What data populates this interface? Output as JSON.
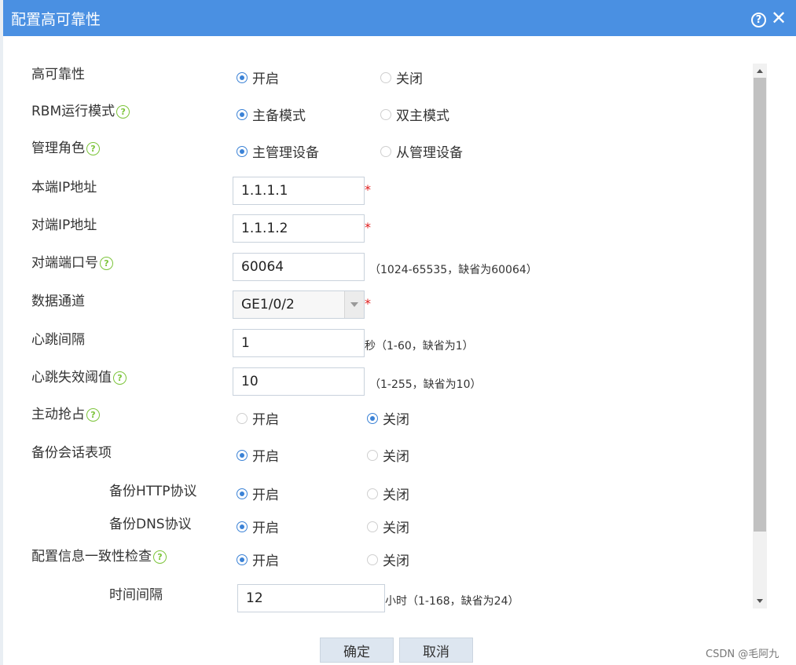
{
  "window": {
    "title": "配置高可靠性",
    "help_glyph": "?",
    "close_glyph": "✕"
  },
  "form": {
    "high_availability": {
      "label": "高可靠性",
      "options": [
        "开启",
        "关闭"
      ],
      "selected": "开启"
    },
    "rbm_mode": {
      "label": "RBM运行模式",
      "options": [
        "主备模式",
        "双主模式"
      ],
      "selected": "主备模式"
    },
    "management_role": {
      "label": "管理角色",
      "options": [
        "主管理设备",
        "从管理设备"
      ],
      "selected": "主管理设备"
    },
    "local_ip": {
      "label": "本端IP地址",
      "value": "1.1.1.1",
      "required": "*"
    },
    "peer_ip": {
      "label": "对端IP地址",
      "value": "1.1.1.2",
      "required": "*"
    },
    "peer_port": {
      "label": "对端端口号",
      "value": "60064",
      "hint": "（1024-65535，缺省为60064）"
    },
    "data_channel": {
      "label": "数据通道",
      "value": "GE1/0/2",
      "required": "*"
    },
    "heartbeat_interval": {
      "label": "心跳间隔",
      "value": "1",
      "hint": "秒（1-60，缺省为1）"
    },
    "heartbeat_threshold": {
      "label": "心跳失效阈值",
      "value": "10",
      "hint": "（1-255，缺省为10）"
    },
    "preemption": {
      "label": "主动抢占",
      "options": [
        "开启",
        "关闭"
      ],
      "selected": "关闭"
    },
    "backup_session": {
      "label": "备份会话表项",
      "options": [
        "开启",
        "关闭"
      ],
      "selected": "开启"
    },
    "backup_http": {
      "label": "备份HTTP协议",
      "options": [
        "开启",
        "关闭"
      ],
      "selected": "开启"
    },
    "backup_dns": {
      "label": "备份DNS协议",
      "options": [
        "开启",
        "关闭"
      ],
      "selected": "开启"
    },
    "config_consistency": {
      "label": "配置信息一致性检查",
      "options": [
        "开启",
        "关闭"
      ],
      "selected": "开启"
    },
    "check_interval": {
      "label": "时间间隔",
      "value": "12",
      "hint": "小时（1-168，缺省为24）"
    }
  },
  "footer": {
    "confirm_label": "确定",
    "cancel_label": "取消"
  },
  "watermark": "CSDN @毛阿九",
  "colors": {
    "titlebar": "#4a90e2",
    "radio_selected": "#3b82d6",
    "help_icon": "#7cc43a",
    "required": "#e01b1b"
  }
}
